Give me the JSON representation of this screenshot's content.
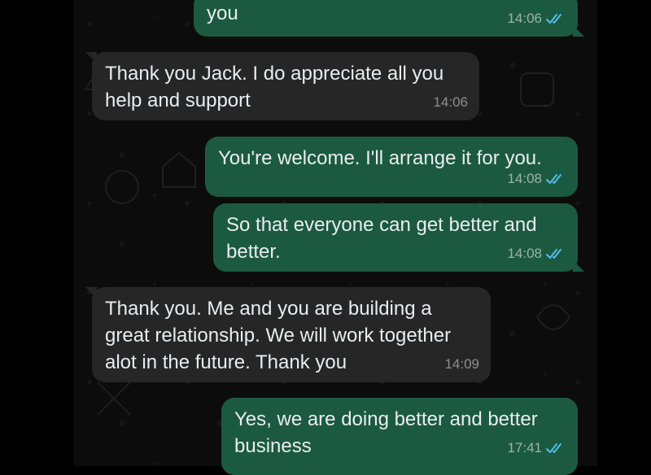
{
  "messages": [
    {
      "direction": "out",
      "text": "you",
      "time": "14:06",
      "status": "read-double-check-icon"
    },
    {
      "direction": "in",
      "text": "Thank you Jack. I do appreciate all you\nhelp and support",
      "time": "14:06"
    },
    {
      "direction": "out",
      "text": "You're welcome. I'll arrange it for you.",
      "time": "14:08",
      "status": "read-double-check-icon"
    },
    {
      "direction": "out",
      "text": "So that everyone can get better and\nbetter.",
      "time": "14:08",
      "status": "read-double-check-icon"
    },
    {
      "direction": "in",
      "text": "Thank you. Me and you are building a\ngreat relationship. We will work together\nalot in the future. Thank you",
      "time": "14:09"
    },
    {
      "direction": "out",
      "text": "Yes, we are doing better and better\nbusiness",
      "time": "17:41",
      "status": "read-double-check-icon"
    }
  ],
  "colors": {
    "outgoing_bubble": "#1b5a40",
    "incoming_bubble": "#262626",
    "read_ticks": "#53bdeb",
    "text": "#e9edef"
  }
}
